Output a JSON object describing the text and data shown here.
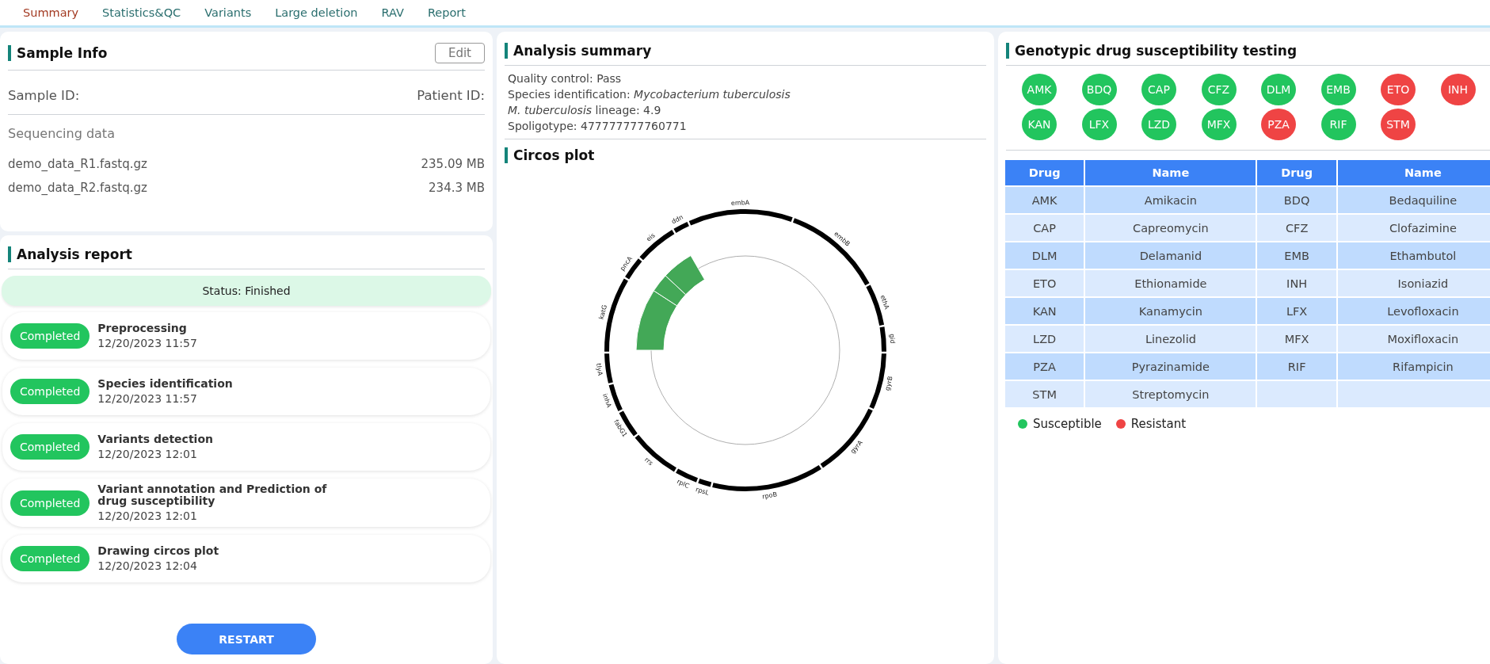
{
  "tabs": [
    {
      "label": "Summary",
      "selected": true
    },
    {
      "label": "Statistics&QC",
      "selected": false
    },
    {
      "label": "Variants",
      "selected": false
    },
    {
      "label": "Large deletion",
      "selected": false
    },
    {
      "label": "RAV",
      "selected": false
    },
    {
      "label": "Report",
      "selected": false
    }
  ],
  "sample_info": {
    "title": "Sample Info",
    "edit_button": "Edit",
    "sample_id_label": "Sample ID:",
    "patient_id_label": "Patient ID:",
    "sequencing_title": "Sequencing data",
    "files": [
      {
        "name": "demo_data_R1.fastq.gz",
        "size": "235.09 MB"
      },
      {
        "name": "demo_data_R2.fastq.gz",
        "size": "234.3 MB"
      }
    ]
  },
  "analysis_report": {
    "title": "Analysis report",
    "status": "Status: Finished",
    "steps": [
      {
        "status": "Completed",
        "title": "Preprocessing",
        "time": "12/20/2023 11:57"
      },
      {
        "status": "Completed",
        "title": "Species identification",
        "time": "12/20/2023 11:57"
      },
      {
        "status": "Completed",
        "title": "Variants detection",
        "time": "12/20/2023 12:01"
      },
      {
        "status": "Completed",
        "title": "Variant annotation and Prediction of drug susceptibility",
        "time": "12/20/2023 12:01"
      },
      {
        "status": "Completed",
        "title": "Drawing circos plot",
        "time": "12/20/2023 12:04"
      }
    ],
    "restart_button": "RESTART"
  },
  "analysis_summary": {
    "title": "Analysis summary",
    "lines": [
      "Quality control: Pass",
      "Species identification: *Mycobacterium tuberculosis*",
      "*M. tuberculosis* lineage: 4.9",
      "Spoligotype: 477777777760771"
    ]
  },
  "circos_plot": {
    "title": "Circos plot",
    "genes": [
      "embA",
      "embB",
      "ethA",
      "gid",
      "gyrB",
      "gyrA",
      "rpoB",
      "rpsL",
      "rplC",
      "rrs",
      "fabG1",
      "inhA",
      "tlyA",
      "katG",
      "pncA",
      "eis",
      "ddn"
    ]
  },
  "dst": {
    "title": "Genotypic drug susceptibility testing",
    "badges": [
      {
        "label": "AMK",
        "color": "#22c55e"
      },
      {
        "label": "BDQ",
        "color": "#22c55e"
      },
      {
        "label": "CAP",
        "color": "#22c55e"
      },
      {
        "label": "CFZ",
        "color": "#22c55e"
      },
      {
        "label": "DLM",
        "color": "#22c55e"
      },
      {
        "label": "EMB",
        "color": "#22c55e"
      },
      {
        "label": "ETO",
        "color": "#ef4444"
      },
      {
        "label": "INH",
        "color": "#ef4444"
      },
      {
        "label": "KAN",
        "color": "#22c55e"
      },
      {
        "label": "LFX",
        "color": "#22c55e"
      },
      {
        "label": "LZD",
        "color": "#22c55e"
      },
      {
        "label": "MFX",
        "color": "#22c55e"
      },
      {
        "label": "PZA",
        "color": "#ef4444"
      },
      {
        "label": "RIF",
        "color": "#22c55e"
      },
      {
        "label": "STM",
        "color": "#ef4444"
      }
    ],
    "table": {
      "columns": [
        "Drug",
        "Name",
        "Drug",
        "Name"
      ],
      "rows": [
        [
          "AMK",
          "Amikacin",
          "BDQ",
          "Bedaquiline"
        ],
        [
          "CAP",
          "Capreomycin",
          "CFZ",
          "Clofazimine"
        ],
        [
          "DLM",
          "Delamanid",
          "EMB",
          "Ethambutol"
        ],
        [
          "ETO",
          "Ethionamide",
          "INH",
          "Isoniazid"
        ],
        [
          "KAN",
          "Kanamycin",
          "LFX",
          "Levofloxacin"
        ],
        [
          "LZD",
          "Linezolid",
          "MFX",
          "Moxifloxacin"
        ],
        [
          "PZA",
          "Pyrazinamide",
          "RIF",
          "Rifampicin"
        ],
        [
          "STM",
          "Streptomycin",
          "",
          ""
        ]
      ]
    },
    "legend": [
      {
        "label": "Susceptible",
        "color": "#22c55e"
      },
      {
        "label": "Resistant",
        "color": "#ef4444"
      }
    ]
  }
}
